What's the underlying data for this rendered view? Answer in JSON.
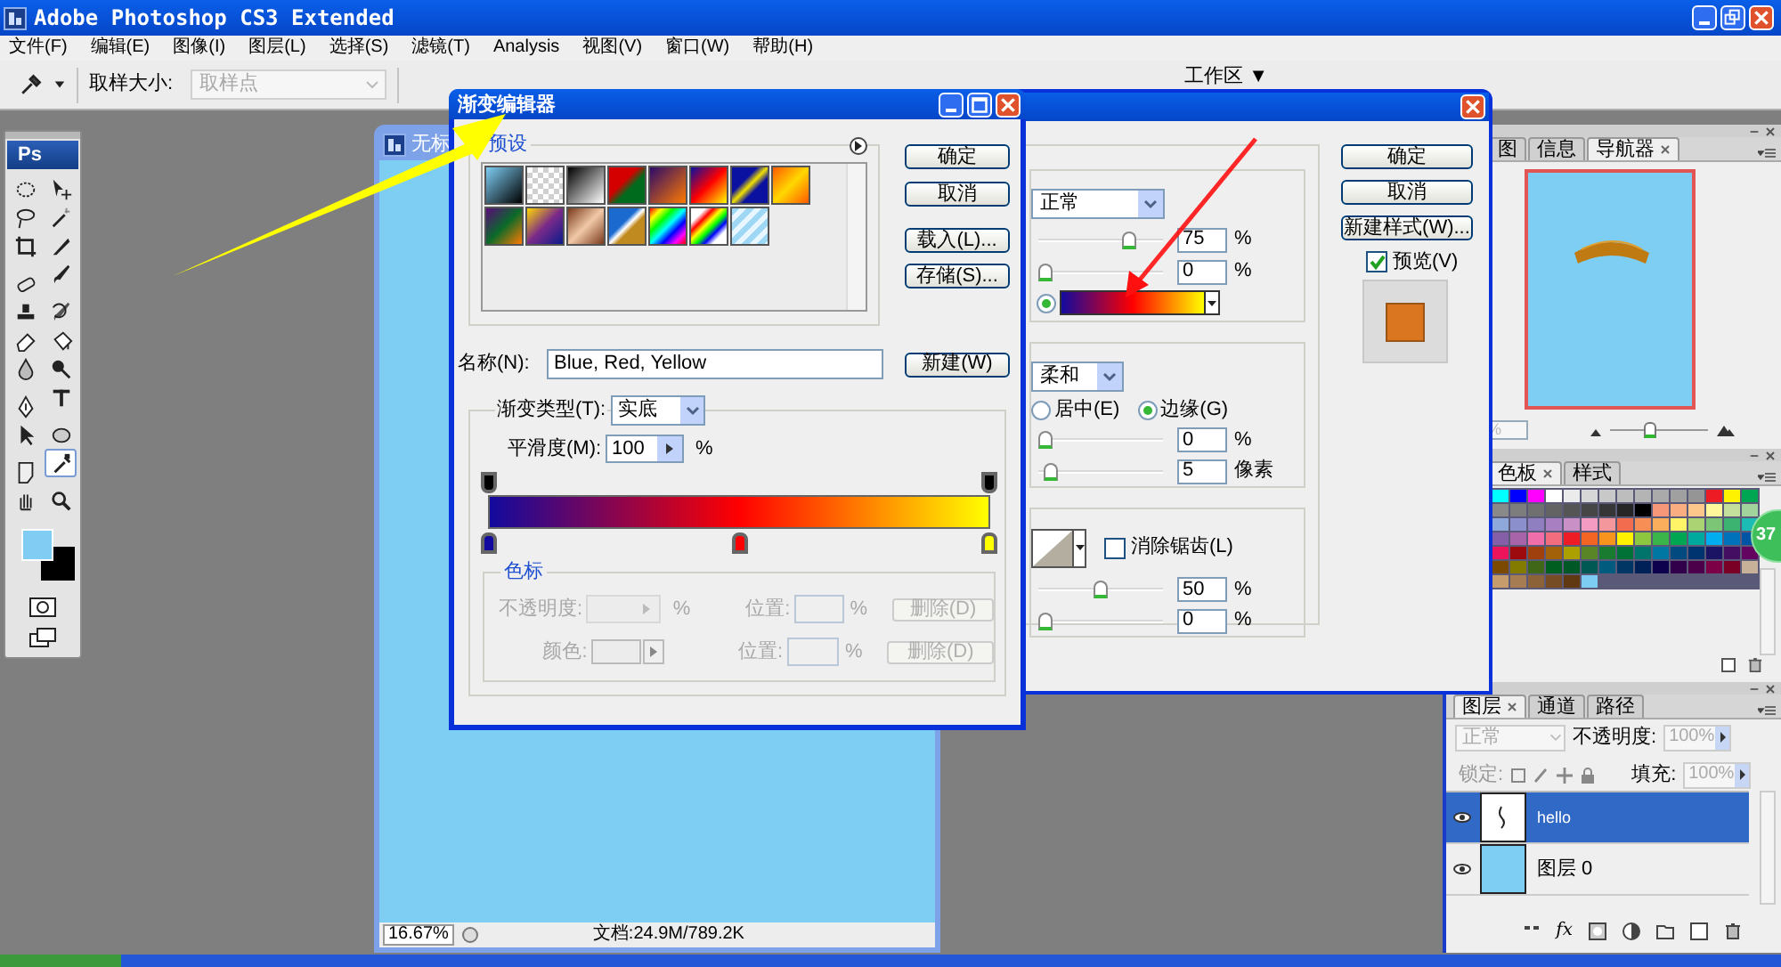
{
  "app": {
    "title": "Adobe Photoshop CS3 Extended",
    "menu": [
      "文件(F)",
      "编辑(E)",
      "图像(I)",
      "图层(L)",
      "选择(S)",
      "滤镜(T)",
      "Analysis",
      "视图(V)",
      "窗口(W)",
      "帮助(H)"
    ]
  },
  "options_bar": {
    "sample_label": "取样大小:",
    "sample_value": "取样点",
    "workspace": "工作区 ▼"
  },
  "toolbox": {
    "logo": "Ps",
    "tools": [
      {
        "selected": false
      },
      {
        "selected": false
      },
      {
        "selected": false
      },
      {
        "selected": false
      },
      {
        "selected": false
      },
      {
        "selected": false
      },
      {
        "selected": false
      },
      {
        "selected": false
      },
      {
        "selected": false
      },
      {
        "selected": false
      },
      {
        "selected": false
      },
      {
        "selected": false
      },
      {
        "selected": false
      },
      {
        "selected": false
      },
      {
        "selected": false
      },
      {
        "selected": false
      },
      {
        "selected": false
      },
      {
        "selected": false
      },
      {
        "selected": false
      },
      {
        "selected": true
      },
      {
        "selected": false
      },
      {
        "selected": false
      }
    ],
    "colors": [
      {
        "color": "#80ccf2"
      },
      {
        "color": "#000000"
      }
    ]
  },
  "document": {
    "title": "无标",
    "zoom": "16.67%",
    "status": "文档:24.9M/789.2K"
  },
  "gradient_editor": {
    "title": "渐变编辑器",
    "presets_label": "预设",
    "buttons": [
      "确定",
      "取消",
      "载入(L)...",
      "存储(S)..."
    ],
    "name_label": "名称(N):",
    "name_value": "Blue, Red, Yellow",
    "new_button": "新建(W)",
    "type_label": "渐变类型(T):",
    "type_value": "实底",
    "smooth_label": "平滑度(M):",
    "smooth_value": "100",
    "smooth_unit": "%",
    "opacity_stops": [
      {
        "selected": false
      },
      {
        "selected": false
      }
    ],
    "color_stops": [
      {
        "color": "#120a9e",
        "selected": false
      },
      {
        "color": "#ff0000",
        "selected": false
      },
      {
        "color": "#ffff00",
        "selected": false
      }
    ],
    "stops_group": {
      "label": "色标",
      "disabled": true,
      "rows": [
        {
          "kind": "opacity",
          "label": "不透明度:",
          "unit": "%",
          "position_label": "位置:",
          "position_unit": "%",
          "delete": "删除(D)"
        },
        {
          "kind": "color",
          "label": "颜色:",
          "position_label": "位置:",
          "position_unit": "%",
          "delete": "删除(D)"
        }
      ]
    }
  },
  "layer_style": {
    "buttons": [
      "确定",
      "取消",
      "新建样式(W)..."
    ],
    "preview": {
      "label": "预览(V)",
      "checked": true
    },
    "sections": [
      {
        "rows": [
          {
            "kind": "select",
            "value": "正常"
          },
          {
            "kind": "slider",
            "level": 0.75,
            "value": "75",
            "unit": "%"
          },
          {
            "kind": "slider",
            "level": 0,
            "value": "0",
            "unit": "%"
          },
          {
            "kind": "gradient",
            "selected": true
          }
        ]
      },
      {
        "rows": [
          {
            "kind": "select",
            "value": "柔和"
          },
          {
            "kind": "radios",
            "options": [
              {
                "label": "居中(E)",
                "selected": false
              },
              {
                "label": "边缘(G)",
                "selected": true
              }
            ]
          },
          {
            "kind": "slider",
            "level": 0,
            "value": "0",
            "unit": "%"
          },
          {
            "kind": "slider",
            "level": 0.05,
            "value": "5",
            "unit": "像素"
          }
        ]
      },
      {
        "rows": [
          {
            "kind": "contour",
            "checkbox": {
              "label": "消除锯齿(L)",
              "checked": false
            }
          },
          {
            "kind": "slider",
            "level": 0.5,
            "value": "50",
            "unit": "%"
          },
          {
            "kind": "slider",
            "level": 0,
            "value": "0",
            "unit": "%"
          }
        ]
      }
    ]
  },
  "navigator": {
    "tabs": [
      {
        "label": "图",
        "selected": false
      },
      {
        "label": "信息",
        "selected": false
      },
      {
        "label": "导航器",
        "selected": true
      }
    ],
    "zoom_value": "%",
    "level": 0.4
  },
  "swatches": {
    "tabs": [
      {
        "label": "色板",
        "selected": true
      },
      {
        "label": "样式",
        "selected": false
      }
    ],
    "items": [
      {
        "color": "#00ffff"
      },
      {
        "color": "#0000ff"
      },
      {
        "color": "#ff00ff"
      },
      {
        "color": "#ffffff"
      },
      {
        "color": "#ebebeb"
      },
      {
        "color": "#d7d7d7"
      },
      {
        "color": "#c8c8c8"
      },
      {
        "color": "#bdbdbd"
      },
      {
        "color": "#b4b4b4"
      },
      {
        "color": "#aaaaaa"
      },
      {
        "color": "#a0a0a0"
      },
      {
        "color": "#959595"
      },
      {
        "color": "#ed1c24"
      },
      {
        "color": "#fff200"
      },
      {
        "color": "#00a651"
      },
      {
        "color": "#898989"
      },
      {
        "color": "#7d7d7d"
      },
      {
        "color": "#707070"
      },
      {
        "color": "#636363"
      },
      {
        "color": "#555555"
      },
      {
        "color": "#464646"
      },
      {
        "color": "#363636"
      },
      {
        "color": "#262626"
      },
      {
        "color": "#000001"
      },
      {
        "color": "#f7977a"
      },
      {
        "color": "#f9ad81"
      },
      {
        "color": "#fdc68a"
      },
      {
        "color": "#fff79a"
      },
      {
        "color": "#c4df9b"
      },
      {
        "color": "#a3d39c"
      },
      {
        "color": "#8fa8dc"
      },
      {
        "color": "#8b8fcc"
      },
      {
        "color": "#8f7fc0"
      },
      {
        "color": "#a87fc0"
      },
      {
        "color": "#c890c4"
      },
      {
        "color": "#f39bc2"
      },
      {
        "color": "#f4979d"
      },
      {
        "color": "#f26c4f"
      },
      {
        "color": "#f68e56"
      },
      {
        "color": "#fbaf5d"
      },
      {
        "color": "#fff467"
      },
      {
        "color": "#acd373"
      },
      {
        "color": "#7cc576"
      },
      {
        "color": "#3cb371"
      },
      {
        "color": "#1cbbb4"
      },
      {
        "color": "#8560a8"
      },
      {
        "color": "#a864a8"
      },
      {
        "color": "#f06ea9"
      },
      {
        "color": "#f26d7d"
      },
      {
        "color": "#ed1c25"
      },
      {
        "color": "#f26522"
      },
      {
        "color": "#f7941d"
      },
      {
        "color": "#fff201"
      },
      {
        "color": "#8dc63f"
      },
      {
        "color": "#39b54a"
      },
      {
        "color": "#00a652"
      },
      {
        "color": "#00a99d"
      },
      {
        "color": "#00aeef"
      },
      {
        "color": "#0072bc"
      },
      {
        "color": "#0054a6"
      },
      {
        "color": "#ed145b"
      },
      {
        "color": "#9e0b0f"
      },
      {
        "color": "#a0410d"
      },
      {
        "color": "#a36209"
      },
      {
        "color": "#aba000"
      },
      {
        "color": "#598527"
      },
      {
        "color": "#197b30"
      },
      {
        "color": "#007236"
      },
      {
        "color": "#00746b"
      },
      {
        "color": "#0076a3"
      },
      {
        "color": "#004a80"
      },
      {
        "color": "#003471"
      },
      {
        "color": "#1b1464"
      },
      {
        "color": "#440e62"
      },
      {
        "color": "#630460"
      },
      {
        "color": "#7b4900"
      },
      {
        "color": "#827b00"
      },
      {
        "color": "#406618"
      },
      {
        "color": "#005e20"
      },
      {
        "color": "#005826"
      },
      {
        "color": "#005952"
      },
      {
        "color": "#005b7f"
      },
      {
        "color": "#003663"
      },
      {
        "color": "#002157"
      },
      {
        "color": "#0d004c"
      },
      {
        "color": "#32004b"
      },
      {
        "color": "#4b0049"
      },
      {
        "color": "#7b0046"
      },
      {
        "color": "#7a0026"
      },
      {
        "color": "#c7b299"
      },
      {
        "color": "#c69c6d"
      },
      {
        "color": "#a67c52"
      },
      {
        "color": "#8c6239"
      },
      {
        "color": "#754c24"
      },
      {
        "color": "#603913"
      },
      {
        "color": "#7dcdf3"
      }
    ]
  },
  "layers": {
    "tabs": [
      {
        "label": "图层",
        "selected": true
      },
      {
        "label": "通道",
        "selected": false
      },
      {
        "label": "路径",
        "selected": false
      }
    ],
    "blend": "正常",
    "footer_fx": "fx",
    "opacity_label": "不透明度:",
    "opacity": "100%",
    "lock_label": "锁定:",
    "fill_label": "填充:",
    "fill": "100%",
    "items": [
      {
        "name": "hello",
        "kind": "text",
        "selected": true,
        "visible": true
      },
      {
        "name": "图层 0",
        "selected": false,
        "visible": true
      }
    ]
  },
  "badge": {
    "text": "37"
  }
}
